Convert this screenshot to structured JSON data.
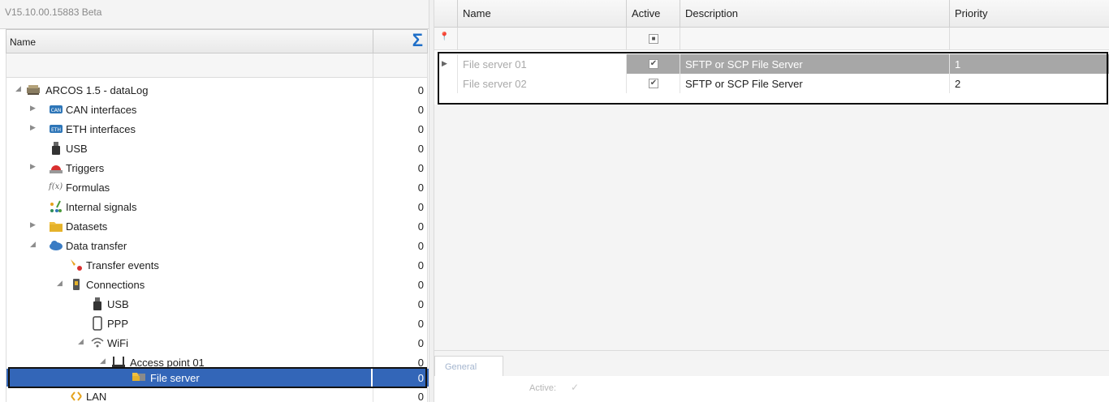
{
  "version": "V15.10.00.15883 Beta",
  "tree": {
    "header_name": "Name",
    "header_sum": "Σ",
    "rows": [
      {
        "label": "ARCOS 1.5 - dataLog",
        "count": "0"
      },
      {
        "label": "CAN interfaces",
        "count": "0"
      },
      {
        "label": "ETH interfaces",
        "count": "0"
      },
      {
        "label": "USB",
        "count": "0"
      },
      {
        "label": "Triggers",
        "count": "0"
      },
      {
        "label": "Formulas",
        "count": "0"
      },
      {
        "label": "Internal signals",
        "count": "0"
      },
      {
        "label": "Datasets",
        "count": "0"
      },
      {
        "label": "Data transfer",
        "count": "0"
      },
      {
        "label": "Transfer events",
        "count": "0"
      },
      {
        "label": "Connections",
        "count": "0"
      },
      {
        "label": "USB",
        "count": "0"
      },
      {
        "label": "PPP",
        "count": "0"
      },
      {
        "label": "WiFi",
        "count": "0"
      },
      {
        "label": "Access point 01",
        "count": "0"
      },
      {
        "label": "File server",
        "count": "0"
      },
      {
        "label": "LAN",
        "count": "0"
      }
    ]
  },
  "grid": {
    "columns": [
      "Name",
      "Active",
      "Description",
      "Priority"
    ],
    "rows": [
      {
        "name": "File server 01",
        "active": "✔",
        "description": "SFTP or SCP File Server",
        "priority": "1"
      },
      {
        "name": "File server 02",
        "active": "✔",
        "description": "SFTP or SCP File Server",
        "priority": "2"
      }
    ]
  },
  "detail": {
    "tab_general": "General",
    "active_label": "Active:",
    "active_value": "✓"
  },
  "colors": {
    "selection": "#3366b8",
    "sigma": "#1f6fc8",
    "row_highlight": "#a7a7a7"
  }
}
